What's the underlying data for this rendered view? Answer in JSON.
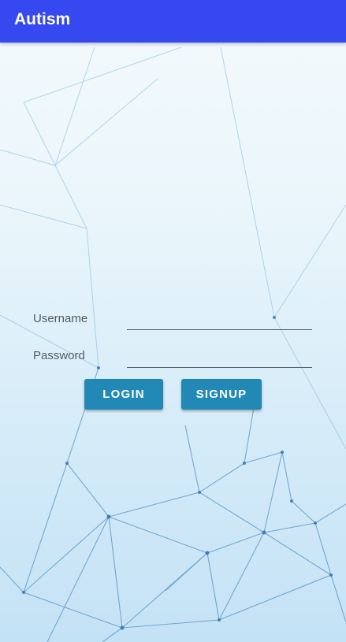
{
  "app_bar": {
    "title": "Autism",
    "color": "#3648f0"
  },
  "form": {
    "username_label": "Username",
    "username_value": "",
    "password_label": "Password",
    "password_value": ""
  },
  "buttons": {
    "login_label": "LOGIN",
    "signup_label": "SIGNUP",
    "color": "#2288b6"
  }
}
